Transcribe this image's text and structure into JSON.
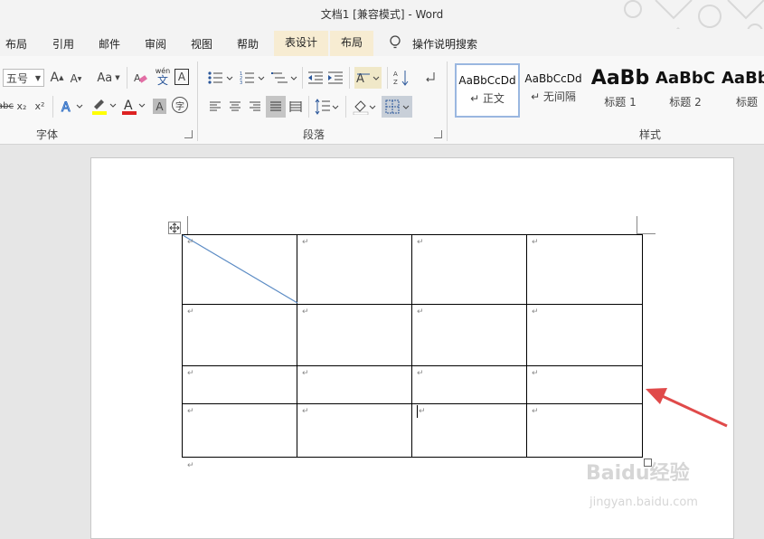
{
  "window": {
    "title": "文档1 [兼容模式]  -  Word"
  },
  "tabs": [
    "布局",
    "引用",
    "邮件",
    "审阅",
    "视图",
    "帮助",
    "表设计",
    "布局"
  ],
  "search": {
    "label": "操作说明搜索"
  },
  "font": {
    "size": "五号",
    "case_label": "Aa",
    "pinyin_top": "wén",
    "pinyin_bottom": "文",
    "box_char": "A",
    "circle_char": "字",
    "subscript": "x₂",
    "superscript": "x²",
    "strike": "abc"
  },
  "groups": {
    "font": "字体",
    "paragraph": "段落",
    "styles": "样式"
  },
  "styles": [
    {
      "preview": "AaBbCcDd",
      "name": "↵ 正文"
    },
    {
      "preview": "AaBbCcDd",
      "name": "↵ 无间隔"
    },
    {
      "preview": "AaBb",
      "name": "标题 1"
    },
    {
      "preview": "AaBbC",
      "name": "标题 2"
    },
    {
      "preview": "AaBb",
      "name": "标题"
    }
  ],
  "document": {
    "paragraph_mark": "↵"
  },
  "colors": {
    "accent": "#2b579a",
    "arrow": "#e04a4a",
    "diagonal": "#5b8bc4"
  },
  "watermark": {
    "logo": "Baidu经验",
    "url": "jingyan.baidu.com"
  }
}
